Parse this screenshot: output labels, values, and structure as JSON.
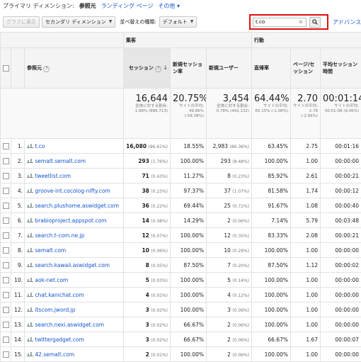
{
  "topbar": {
    "primary_dim_label": "プライマリ ディメンション:",
    "current_dim": "参照元",
    "landing_page": "ランディング ページ",
    "other": "その他 ▾"
  },
  "toolbar": {
    "graph_button": "グラフに表示",
    "secondary_dim": "セカンダリ ディメンション",
    "sort_type_label": "並べ替えの種類:",
    "sort_default": "デフォルト",
    "search_value": "t.co",
    "advanced": "アドバンス"
  },
  "headers": {
    "group_acquisition": "集客",
    "group_behavior": "行動",
    "source": "参照元",
    "sessions": "セッション",
    "new_session_rate": "新規セッション率",
    "new_users": "新規ユーザー",
    "bounce_rate": "直帰率",
    "pages_per_session": "ページ/セッション",
    "avg_duration": "平均セッション時間"
  },
  "totals": {
    "sessions": "16,644",
    "sessions_sub": "全体に対する割合: 1.88% (886,713)",
    "new_session_rate": "20.75%",
    "new_session_rate_sub": "サイトの平均: 49.86% (-58.38%)",
    "new_users": "3,454",
    "new_users_sub": "全体に対する割合: 0.78% (442,132)",
    "bounce_rate": "64.44%",
    "bounce_rate_sub": "サイトの平均: 65.15% (-1.08%)",
    "pages": "2.70",
    "pages_sub": "サイトの平均: 2.78 (-2.66%)",
    "duration": "00:01:14",
    "duration_sub": "サイトの平均: 00:01:08 (9.06%)"
  },
  "rows": [
    {
      "idx": "1.",
      "source": "t.co",
      "sessions": "16,080",
      "sessions_pct": "(96.61%)",
      "nsr": "18.55%",
      "nu": "2,983",
      "nu_pct": "(86.36%)",
      "br": "63.45%",
      "pps": "2.75",
      "dur": "00:01:16"
    },
    {
      "idx": "2.",
      "source": "semalt.semalt.com",
      "sessions": "293",
      "sessions_pct": "(1.76%)",
      "nsr": "100.00%",
      "nu": "293",
      "nu_pct": "(8.48%)",
      "br": "100.00%",
      "pps": "1.00",
      "dur": "00:00:00"
    },
    {
      "idx": "3.",
      "source": "tweetlist.com",
      "sessions": "71",
      "sessions_pct": "(0.43%)",
      "nsr": "11.27%",
      "nu": "8",
      "nu_pct": "(0.23%)",
      "br": "85.92%",
      "pps": "2.61",
      "dur": "00:00:21"
    },
    {
      "idx": "4.",
      "source": "groove-int.cocolog-nifty.com",
      "sessions": "38",
      "sessions_pct": "(0.23%)",
      "nsr": "97.37%",
      "nu": "37",
      "nu_pct": "(1.07%)",
      "br": "81.58%",
      "pps": "1.74",
      "dur": "00:00:12"
    },
    {
      "idx": "5.",
      "source": "search.plushome.aswidget.com",
      "sessions": "36",
      "sessions_pct": "(0.22%)",
      "nsr": "69.44%",
      "nu": "25",
      "nu_pct": "(0.72%)",
      "br": "91.67%",
      "pps": "1.08",
      "dur": "00:00:40"
    },
    {
      "idx": "6.",
      "source": "brabioproject.appspot.com",
      "sessions": "14",
      "sessions_pct": "(0.08%)",
      "nsr": "14.29%",
      "nu": "2",
      "nu_pct": "(0.06%)",
      "br": "7.14%",
      "pps": "5.79",
      "dur": "00:03:48"
    },
    {
      "idx": "7.",
      "source": "search.t-com.ne.jp",
      "sessions": "12",
      "sessions_pct": "(0.07%)",
      "nsr": "100.00%",
      "nu": "12",
      "nu_pct": "(0.35%)",
      "br": "83.33%",
      "pps": "2.08",
      "dur": "00:00:21"
    },
    {
      "idx": "8.",
      "source": "semalt.com",
      "sessions": "10",
      "sessions_pct": "(0.06%)",
      "nsr": "100.00%",
      "nu": "10",
      "nu_pct": "(0.29%)",
      "br": "100.00%",
      "pps": "1.00",
      "dur": "00:00:00"
    },
    {
      "idx": "9.",
      "source": "search.kawaii.aswidget.com",
      "sessions": "8",
      "sessions_pct": "(0.05%)",
      "nsr": "87.50%",
      "nu": "7",
      "nu_pct": "(0.20%)",
      "br": "87.50%",
      "pps": "1.12",
      "dur": "00:00:02"
    },
    {
      "idx": "10.",
      "source": "aok-net.com",
      "sessions": "5",
      "sessions_pct": "(0.03%)",
      "nsr": "100.00%",
      "nu": "5",
      "nu_pct": "(0.14%)",
      "br": "100.00%",
      "pps": "1.00",
      "dur": "00:00:00"
    },
    {
      "idx": "11.",
      "source": "chat.kanichat.com",
      "sessions": "4",
      "sessions_pct": "(0.02%)",
      "nsr": "100.00%",
      "nu": "4",
      "nu_pct": "(0.12%)",
      "br": "100.00%",
      "pps": "1.00",
      "dur": "00:00:00"
    },
    {
      "idx": "12.",
      "source": "itscom.jword.jp",
      "sessions": "3",
      "sessions_pct": "(0.02%)",
      "nsr": "100.00%",
      "nu": "3",
      "nu_pct": "(0.09%)",
      "br": "100.00%",
      "pps": "1.00",
      "dur": "00:00:00"
    },
    {
      "idx": "13.",
      "source": "search.nexi.aswidget.com",
      "sessions": "3",
      "sessions_pct": "(0.02%)",
      "nsr": "66.67%",
      "nu": "2",
      "nu_pct": "(0.06%)",
      "br": "100.00%",
      "pps": "1.00",
      "dur": "00:00:00"
    },
    {
      "idx": "14.",
      "source": "twittergadget.com",
      "sessions": "3",
      "sessions_pct": "(0.02%)",
      "nsr": "66.67%",
      "nu": "2",
      "nu_pct": "(0.06%)",
      "br": "66.67%",
      "pps": "1.67",
      "dur": "00:00:07"
    },
    {
      "idx": "15.",
      "source": "42.semalt.com",
      "sessions": "2",
      "sessions_pct": "(0.01%)",
      "nsr": "100.00%",
      "nu": "2",
      "nu_pct": "(0.06%)",
      "br": "100.00%",
      "pps": "1.00",
      "dur": "00:00:00"
    }
  ]
}
